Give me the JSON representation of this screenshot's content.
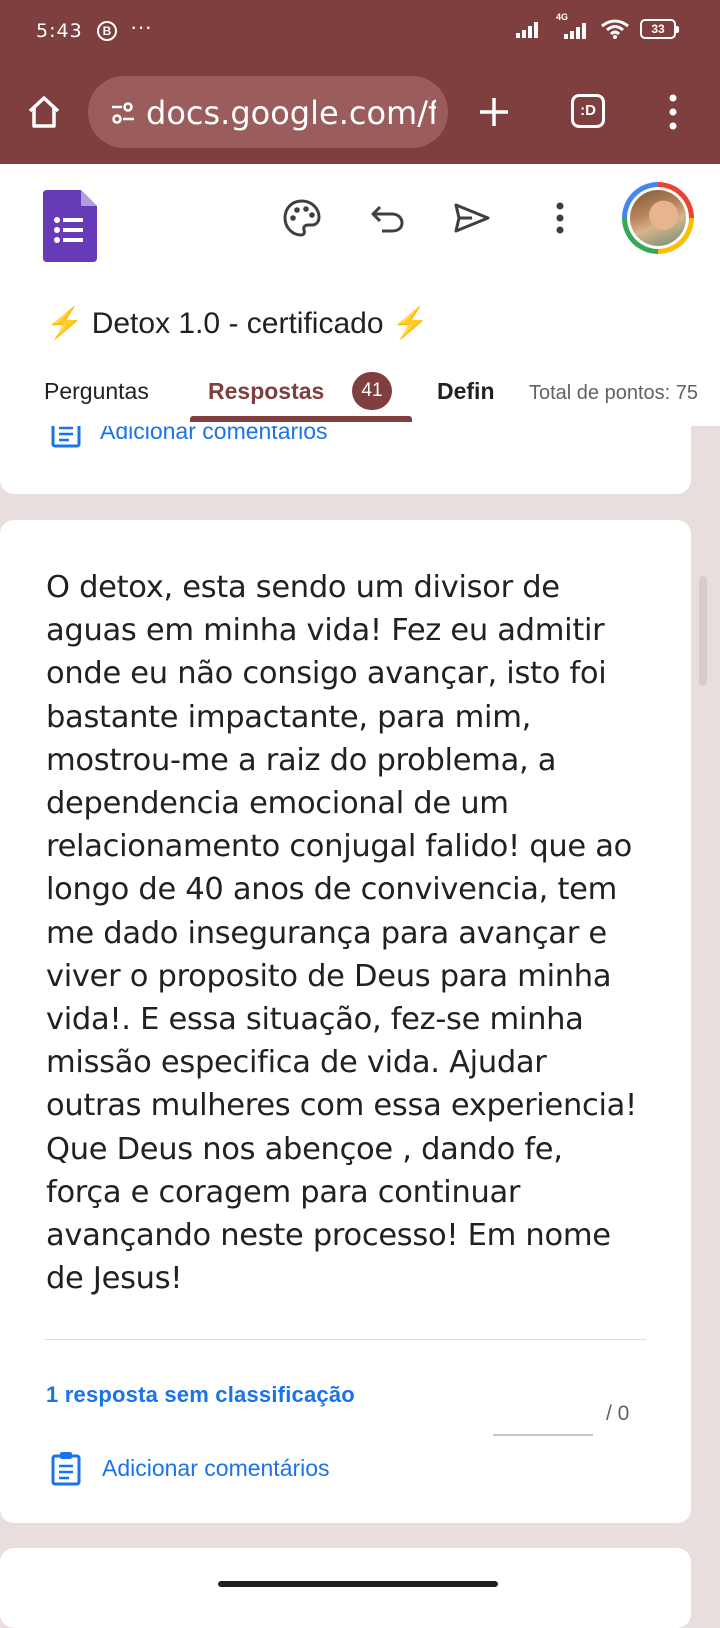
{
  "status_bar": {
    "time": "5:43",
    "notification_badge": "B",
    "more_dots": "···",
    "network": "4G",
    "battery": "33"
  },
  "browser": {
    "url": "docs.google.com/forms",
    "tab_button": ":D"
  },
  "form": {
    "title_emoji": "⚡",
    "title": "Detox 1.0 - certificado",
    "tabs": {
      "questions": "Perguntas",
      "responses": "Respostas",
      "responses_count": "41",
      "settings": "Defin"
    },
    "points_total": "Total de pontos: 75"
  },
  "previous_card": {
    "add_comment": "Adicionar comentários"
  },
  "response_card": {
    "answer": "O detox, esta sendo um divisor de aguas em minha vida! Fez eu admitir onde eu não consigo avançar, isto foi bastante impactante, para mim, mostrou-me a raiz do problema, a dependencia emocional de um relacionamento conjugal falido! que ao longo de 40 anos de convivencia, tem me dado insegurança para avançar e viver o proposito de Deus para minha vida!. E essa situação, fez-se minha missão especifica de vida. Ajudar outras mulheres com essa experiencia! Que Deus nos abençoe , dando fe, força e coragem para continuar avançando neste processo! Em nome de Jesus!",
    "ungraded": "1 resposta sem classificação",
    "score_max": "/  0",
    "add_comment": "Adicionar comentários"
  },
  "colors": {
    "theme": "#803f3f",
    "url_box": "#9b5c5c",
    "page_background": "#e8dede",
    "link": "#1a73e8",
    "forms_purple": "#673ab7"
  }
}
